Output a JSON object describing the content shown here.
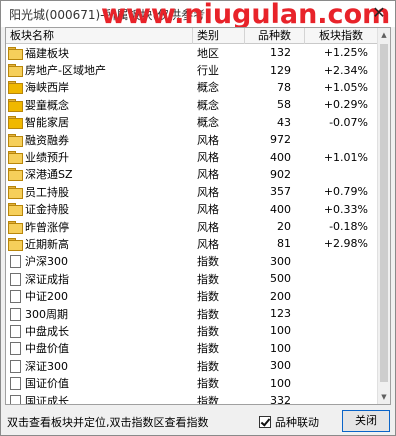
{
  "window": {
    "title": "阳光城(000671)-所属板块(仅供参考",
    "watermark": "www.niugulan.com",
    "close_glyph": "✕"
  },
  "table": {
    "columns": [
      "板块名称",
      "类别",
      "品种数",
      "板块指数"
    ],
    "rows": [
      {
        "icon": "folder",
        "name": "福建板块",
        "type": "地区",
        "count": "132",
        "index": "+1.25%"
      },
      {
        "icon": "folder",
        "name": "房地产-区域地产",
        "type": "行业",
        "count": "129",
        "index": "+2.34%"
      },
      {
        "icon": "folder-gold",
        "name": "海峡西岸",
        "type": "概念",
        "count": "78",
        "index": "+1.05%"
      },
      {
        "icon": "folder-gold",
        "name": "婴童概念",
        "type": "概念",
        "count": "58",
        "index": "+0.29%"
      },
      {
        "icon": "folder-gold",
        "name": "智能家居",
        "type": "概念",
        "count": "43",
        "index": "-0.07%"
      },
      {
        "icon": "folder",
        "name": "融资融券",
        "type": "风格",
        "count": "972",
        "index": ""
      },
      {
        "icon": "folder",
        "name": "业绩预升",
        "type": "风格",
        "count": "400",
        "index": "+1.01%"
      },
      {
        "icon": "folder",
        "name": "深港通SZ",
        "type": "风格",
        "count": "902",
        "index": ""
      },
      {
        "icon": "folder",
        "name": "员工持股",
        "type": "风格",
        "count": "357",
        "index": "+0.79%"
      },
      {
        "icon": "folder",
        "name": "证金持股",
        "type": "风格",
        "count": "400",
        "index": "+0.33%"
      },
      {
        "icon": "folder",
        "name": "昨曾涨停",
        "type": "风格",
        "count": "20",
        "index": "-0.18%"
      },
      {
        "icon": "folder",
        "name": "近期新高",
        "type": "风格",
        "count": "81",
        "index": "+2.98%"
      },
      {
        "icon": "doc",
        "name": "沪深300",
        "type": "指数",
        "count": "300",
        "index": ""
      },
      {
        "icon": "doc",
        "name": "深证成指",
        "type": "指数",
        "count": "500",
        "index": ""
      },
      {
        "icon": "doc",
        "name": "中证200",
        "type": "指数",
        "count": "200",
        "index": ""
      },
      {
        "icon": "doc",
        "name": "300周期",
        "type": "指数",
        "count": "123",
        "index": ""
      },
      {
        "icon": "doc",
        "name": "中盘成长",
        "type": "指数",
        "count": "100",
        "index": ""
      },
      {
        "icon": "doc",
        "name": "中盘价值",
        "type": "指数",
        "count": "100",
        "index": ""
      },
      {
        "icon": "doc",
        "name": "深证300",
        "type": "指数",
        "count": "300",
        "index": ""
      },
      {
        "icon": "doc",
        "name": "国证价值",
        "type": "指数",
        "count": "100",
        "index": ""
      },
      {
        "icon": "doc",
        "name": "国证成长",
        "type": "指数",
        "count": "332",
        "index": ""
      }
    ]
  },
  "status": {
    "hint": "双击查看板块并定位,双击指数区查看指数",
    "checkbox_label": "品种联动",
    "checkbox_checked": true,
    "close_button": "关闭"
  }
}
